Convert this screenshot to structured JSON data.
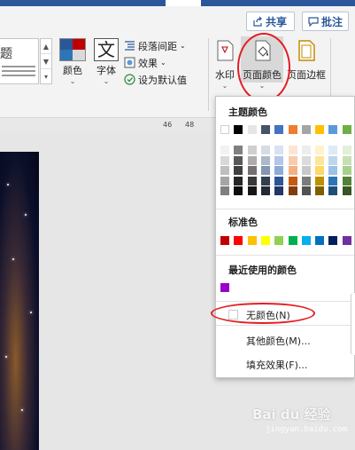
{
  "titlebar": {
    "accent": "#2b579a"
  },
  "header": {
    "share_label": "共享",
    "comment_label": "批注"
  },
  "ribbon": {
    "style_gallery_text": "题",
    "colors_label": "颜色",
    "fonts_label": "字体",
    "fonts_icon_text": "文",
    "paragraph_spacing_label": "段落间距",
    "effects_label": "效果",
    "set_default_label": "设为默认值",
    "watermark_label": "水印",
    "page_color_label": "页面颜色",
    "page_borders_label": "页面边框"
  },
  "ruler": {
    "ticks": [
      "46",
      "48"
    ]
  },
  "dropdown": {
    "theme_colors_heading": "主题颜色",
    "standard_colors_heading": "标准色",
    "recent_colors_heading": "最近使用的颜色",
    "no_color_label": "无颜色(N)",
    "more_colors_label": "其他颜色(M)...",
    "fill_effects_label": "填充效果(F)...",
    "theme_top_row": [
      "#ffffff",
      "#000000",
      "#e7e6e6",
      "#44546a",
      "#4472c4",
      "#ed7d31",
      "#a5a5a5",
      "#ffc000",
      "#5b9bd5",
      "#70ad47"
    ],
    "theme_shades": [
      [
        "#f2f2f2",
        "#808080",
        "#d0cece",
        "#d6dce4",
        "#d9e2f3",
        "#fbe5d5",
        "#ededed",
        "#fff2cc",
        "#deeaf6",
        "#e2efd9"
      ],
      [
        "#d8d8d8",
        "#595959",
        "#aeabab",
        "#adb9ca",
        "#b4c6e7",
        "#f7cbac",
        "#dbdbdb",
        "#ffe598",
        "#bdd6ee",
        "#c5e0b3"
      ],
      [
        "#bfbfbf",
        "#404040",
        "#757070",
        "#8496b0",
        "#8eaadb",
        "#f4b183",
        "#c9c9c9",
        "#ffd965",
        "#9cc2e5",
        "#a8d08d"
      ],
      [
        "#a5a5a5",
        "#262626",
        "#3a3838",
        "#323f4f",
        "#2f5496",
        "#c55a11",
        "#7b7b7b",
        "#bf9000",
        "#2e75b5",
        "#538135"
      ],
      [
        "#7f7f7f",
        "#0d0d0d",
        "#171616",
        "#222a35",
        "#1f3864",
        "#833c0b",
        "#525252",
        "#7f6000",
        "#1e4e79",
        "#375623"
      ]
    ],
    "standard_colors": [
      "#c00000",
      "#ff0000",
      "#ffc000",
      "#ffff00",
      "#92d050",
      "#00b050",
      "#00b0f0",
      "#0070c0",
      "#002060",
      "#7030a0"
    ],
    "recent_colors": [
      "#9900cc"
    ]
  },
  "annotation_color": "#e31e24",
  "watermark_text": "Bai du 经验",
  "watermark_url": "jingyan.baidu.com"
}
